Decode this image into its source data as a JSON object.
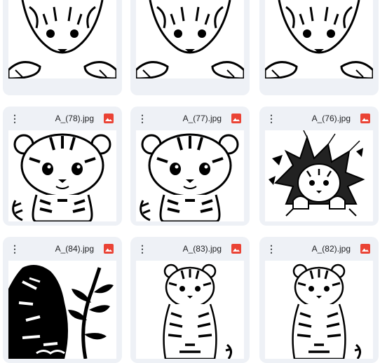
{
  "files": [
    {
      "name": "",
      "art": "tiger-cub-paws"
    },
    {
      "name": "",
      "art": "tiger-cub-paws"
    },
    {
      "name": "",
      "art": "tiger-cub-paws"
    },
    {
      "name": "A_(78).jpg",
      "art": "tiger-cub-sitting-cartoon"
    },
    {
      "name": "A_(77).jpg",
      "art": "tiger-cub-sitting-cartoon"
    },
    {
      "name": "A_(76).jpg",
      "art": "tiger-cub-breaking-wall"
    },
    {
      "name": "A_(84).jpg",
      "art": "tiger-silhouette-leaves"
    },
    {
      "name": "A_(83).jpg",
      "art": "tiger-cub-sitting-sketch"
    },
    {
      "name": "A_(82).jpg",
      "art": "tiger-cub-sitting-sketch"
    }
  ],
  "icons": {
    "menu": "more-vert-icon",
    "file_type": "image-file-icon"
  },
  "colors": {
    "card_bg": "#eef1f6",
    "image_icon": "#ea4335"
  }
}
